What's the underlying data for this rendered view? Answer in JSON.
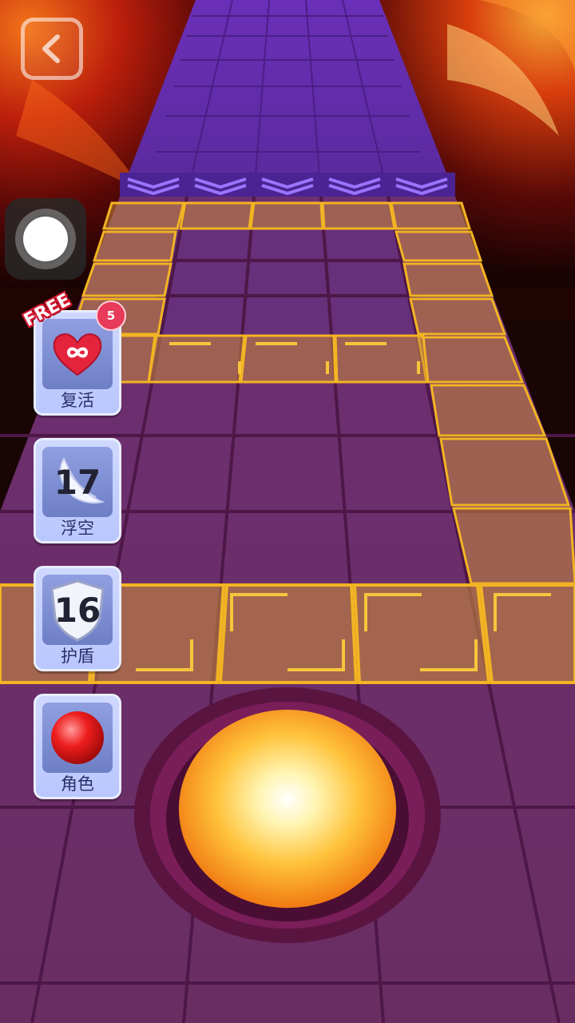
{
  "game": {
    "title": "",
    "track_color": "#6b2f6e",
    "accent_color": "#f2b423",
    "arrow_color": "#8f6bff"
  },
  "top_bar": {
    "back_icon": "chevron-left-icon"
  },
  "assistive_touch": {
    "icon": "assistive-touch-icon"
  },
  "powerups": {
    "revive": {
      "label": "复活",
      "icon": "infinity-heart-icon",
      "free_tag": "FREE",
      "badge_count": "5"
    },
    "float": {
      "label": "浮空",
      "icon": "wing-icon",
      "count": "17"
    },
    "shield": {
      "label": "护盾",
      "icon": "shield-icon",
      "count": "16"
    },
    "character": {
      "label": "角色",
      "icon": "red-ball-icon"
    }
  },
  "player": {
    "icon": "glowing-ball-icon"
  }
}
